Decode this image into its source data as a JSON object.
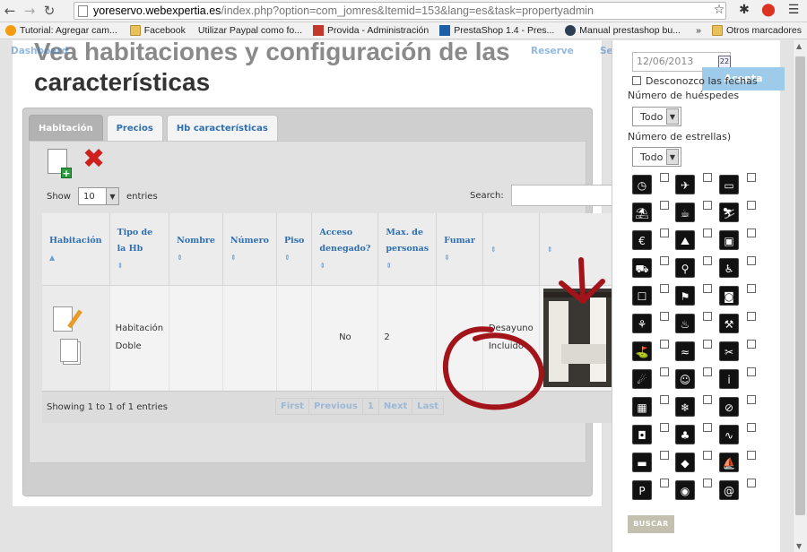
{
  "browser": {
    "url_host": "yoreservo.webexpertia.es",
    "url_path": "/index.php?option=com_jomres&Itemid=153&lang=es&task=propertyadmin",
    "bookmarks": [
      {
        "label": "Tutorial: Agregar cam...",
        "icon": "joomla-icon"
      },
      {
        "label": "Facebook",
        "icon": "folder-icon"
      },
      {
        "label": "Utilizar Paypal como fo...",
        "icon": "page-icon"
      },
      {
        "label": "Provida - Administración",
        "icon": "provida-icon"
      },
      {
        "label": "PrestaShop 1.4 - Pres...",
        "icon": "prestashop-icon"
      },
      {
        "label": "Manual prestashop bu...",
        "icon": "manual-icon"
      }
    ],
    "overflow": "»",
    "other_bookmarks": "Otros marcadores"
  },
  "topnav": {
    "items": [
      "Dashboard",
      "Reserve",
      "Settings"
    ]
  },
  "page": {
    "title_overlap": "Vea habitaciones y configuración de las",
    "title_main": "características"
  },
  "tabs": [
    "Habitación",
    "Precios",
    "Hb características"
  ],
  "table": {
    "show_label": "Show",
    "entries_value": "10",
    "entries_label": "entries",
    "search_label": "Search:",
    "columns": [
      "Habitación",
      "Tipo de la Hb",
      "Nombre",
      "Número",
      "Piso",
      "Acceso denegado?",
      "Max. de personas",
      "Fumar",
      "",
      ""
    ],
    "row": {
      "tipo": "Habitación Doble",
      "nombre": "",
      "numero": "",
      "piso": "",
      "acceso": "No",
      "max_personas": "2",
      "fumar": "",
      "extra": "Desayuno Incluido"
    },
    "info": "Showing 1 to 1 of 1 entries",
    "pager": [
      "First",
      "Previous",
      "1",
      "Next",
      "Last"
    ]
  },
  "sidebar": {
    "date_value": "12/06/2013",
    "cal_icon_label": "22",
    "aceptar": "Acepta",
    "unknown_dates": "Desconozco las fechas",
    "guests_label": "Número de huéspedes",
    "guests_value": "Todo",
    "stars_label": "Número de estrellas)",
    "stars_value": "Todo",
    "buscar": "BUSCAR",
    "facilities": [
      "clock-icon",
      "plane-icon",
      "bathtub-icon",
      "beach-icon",
      "teapot-icon",
      "ski-icon",
      "euro-icon",
      "climb-icon",
      "tv-icon",
      "car-icon",
      "bicycle-icon",
      "wheelchair-icon",
      "wc-icon",
      "hike-icon",
      "dvd-icon",
      "stroller-icon",
      "sauna-icon",
      "cleaning-icon",
      "golf-icon",
      "swimming-icon",
      "tools-icon",
      "hairdryer-icon",
      "family-icon",
      "info-icon",
      "kitchen-icon",
      "snowflake-icon",
      "no-smoking-icon",
      "laundry-icon",
      "games-icon",
      "pool-icon",
      "iron-icon",
      "tour-icon",
      "boat-icon",
      "parking-icon",
      "wifi-icon",
      "www-icon"
    ]
  },
  "colors": {
    "link_blue": "#2f6fb0",
    "annotation_red": "#a3141a",
    "delete_red": "#d01f1f",
    "aceptar_blue": "#9ecbe9"
  }
}
